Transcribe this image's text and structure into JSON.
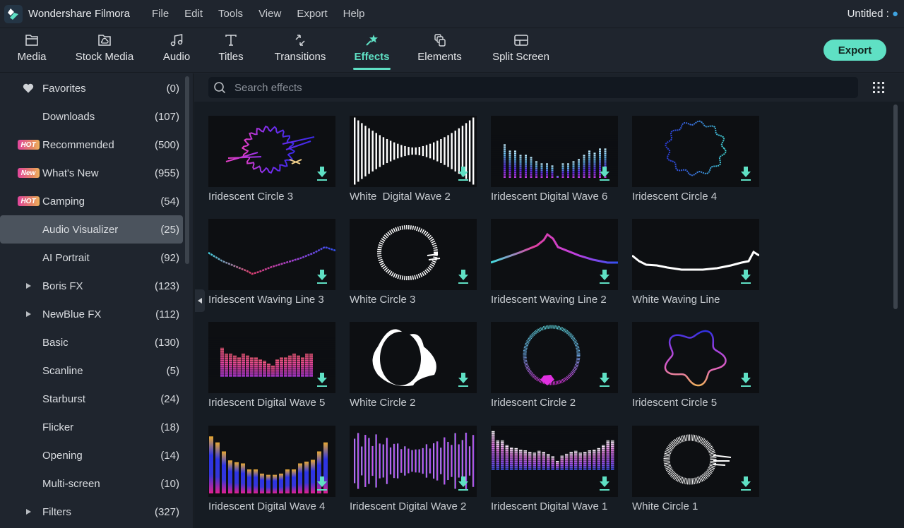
{
  "app": {
    "name": "Wondershare Filmora",
    "document_title": "Untitled :",
    "menu": [
      "File",
      "Edit",
      "Tools",
      "View",
      "Export",
      "Help"
    ]
  },
  "toolbar": {
    "tabs": [
      {
        "label": "Media",
        "icon": "folder-icon"
      },
      {
        "label": "Stock Media",
        "icon": "cloud-folder-icon"
      },
      {
        "label": "Audio",
        "icon": "music-note-icon"
      },
      {
        "label": "Titles",
        "icon": "text-t-icon"
      },
      {
        "label": "Transitions",
        "icon": "transition-arrows-icon"
      },
      {
        "label": "Effects",
        "icon": "magic-star-icon",
        "active": true
      },
      {
        "label": "Elements",
        "icon": "layers-icon"
      },
      {
        "label": "Split Screen",
        "icon": "split-screen-icon"
      }
    ],
    "export_label": "Export"
  },
  "sidebar": {
    "items": [
      {
        "label": "Favorites",
        "count": "(0)",
        "lead": "heart"
      },
      {
        "label": "Downloads",
        "count": "(107)"
      },
      {
        "label": "Recommended",
        "count": "(500)",
        "badge": "HOT"
      },
      {
        "label": "What's New",
        "count": "(955)",
        "badge": "New"
      },
      {
        "label": "Camping",
        "count": "(54)",
        "badge": "HOT"
      },
      {
        "label": "Audio Visualizer",
        "count": "(25)",
        "selected": true
      },
      {
        "label": "AI Portrait",
        "count": "(92)"
      },
      {
        "label": "Boris FX",
        "count": "(123)",
        "lead": "expand"
      },
      {
        "label": "NewBlue FX",
        "count": "(112)",
        "lead": "expand"
      },
      {
        "label": "Basic",
        "count": "(130)"
      },
      {
        "label": "Scanline",
        "count": "(5)"
      },
      {
        "label": "Starburst",
        "count": "(24)"
      },
      {
        "label": "Flicker",
        "count": "(18)"
      },
      {
        "label": "Opening",
        "count": "(14)"
      },
      {
        "label": "Multi-screen",
        "count": "(10)"
      },
      {
        "label": "Filters",
        "count": "(327)",
        "lead": "expand"
      }
    ]
  },
  "search": {
    "placeholder": "Search effects",
    "value": ""
  },
  "colors": {
    "accent": "#5fe0c4",
    "background": "#1f252e",
    "content_bg": "#161c23"
  },
  "effects": [
    {
      "title": "Iridescent Circle 3",
      "art": "circle-jagged"
    },
    {
      "title": "White  Digital Wave 2",
      "art": "white-hourglass"
    },
    {
      "title": "Iridescent Digital Wave 6",
      "art": "dots-bars"
    },
    {
      "title": "Iridescent Circle 4",
      "art": "circle-blue"
    },
    {
      "title": "Iridescent Waving Line 3",
      "art": "valley-line"
    },
    {
      "title": "White Circle 3",
      "art": "white-ring"
    },
    {
      "title": "Iridescent Waving Line 2",
      "art": "peak-line"
    },
    {
      "title": "White Waving Line",
      "art": "white-line"
    },
    {
      "title": "Iridescent Digital Wave 5",
      "art": "pink-bars"
    },
    {
      "title": "White Circle 2",
      "art": "white-blob"
    },
    {
      "title": "Iridescent Circle 2",
      "art": "cyan-ring"
    },
    {
      "title": "Iridescent Circle 5",
      "art": "wobbly-ring"
    },
    {
      "title": "Iridescent Digital Wave 4",
      "art": "gold-bars"
    },
    {
      "title": "Iridescent Digital Wave 2",
      "art": "purple-hourglass"
    },
    {
      "title": "Iridescent Digital Wave 1",
      "art": "violet-bars"
    },
    {
      "title": "White Circle 1",
      "art": "white-spiky-ring"
    }
  ]
}
